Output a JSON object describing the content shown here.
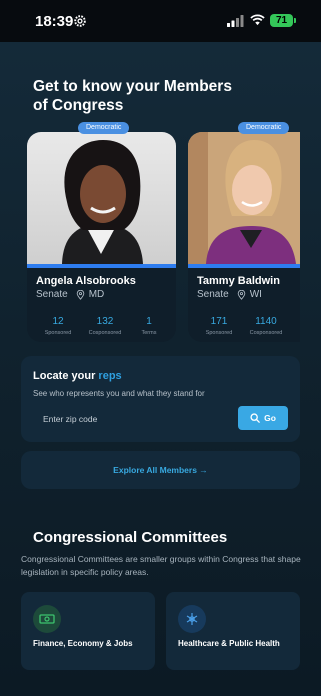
{
  "status_bar": {
    "time": "18:39",
    "battery": "71",
    "icons": [
      "gear-icon",
      "signal-icon",
      "wifi-icon",
      "battery-icon"
    ]
  },
  "hero": {
    "title": "Get to know your Members of Congress"
  },
  "members": [
    {
      "party": "Democratic",
      "name": "Angela Alsobrooks",
      "chamber": "Senate",
      "state": "MD",
      "stats": [
        {
          "value": "12",
          "label": "Sponsored"
        },
        {
          "value": "132",
          "label": "Cosponsored"
        },
        {
          "value": "1",
          "label": "Terms"
        }
      ]
    },
    {
      "party": "Democratic",
      "name": "Tammy Baldwin",
      "chamber": "Senate",
      "state": "WI",
      "stats": [
        {
          "value": "171",
          "label": "Sponsored"
        },
        {
          "value": "1140",
          "label": "Cosponsored"
        }
      ]
    }
  ],
  "locate": {
    "title_prefix": "Locate your",
    "title_accent": "reps",
    "subtitle": "See who represents you and what they stand for",
    "zip_placeholder": "Enter zip code",
    "go_label": "Go"
  },
  "explore": {
    "label": "Explore All Members →"
  },
  "committees": {
    "title": "Congressional Committees",
    "description": "Congressional Committees are smaller groups within Congress that shape legislation in specific policy areas.",
    "items": [
      {
        "label": "Finance, Economy & Jobs",
        "icon": "money-icon",
        "color": "#2f9e57"
      },
      {
        "label": "Healthcare & Public Health",
        "icon": "medical-icon",
        "color": "#3a8fd8"
      }
    ]
  },
  "colors": {
    "accent": "#38a9e0",
    "party_democratic": "#4a90e2",
    "card_bg": "#13293a"
  }
}
